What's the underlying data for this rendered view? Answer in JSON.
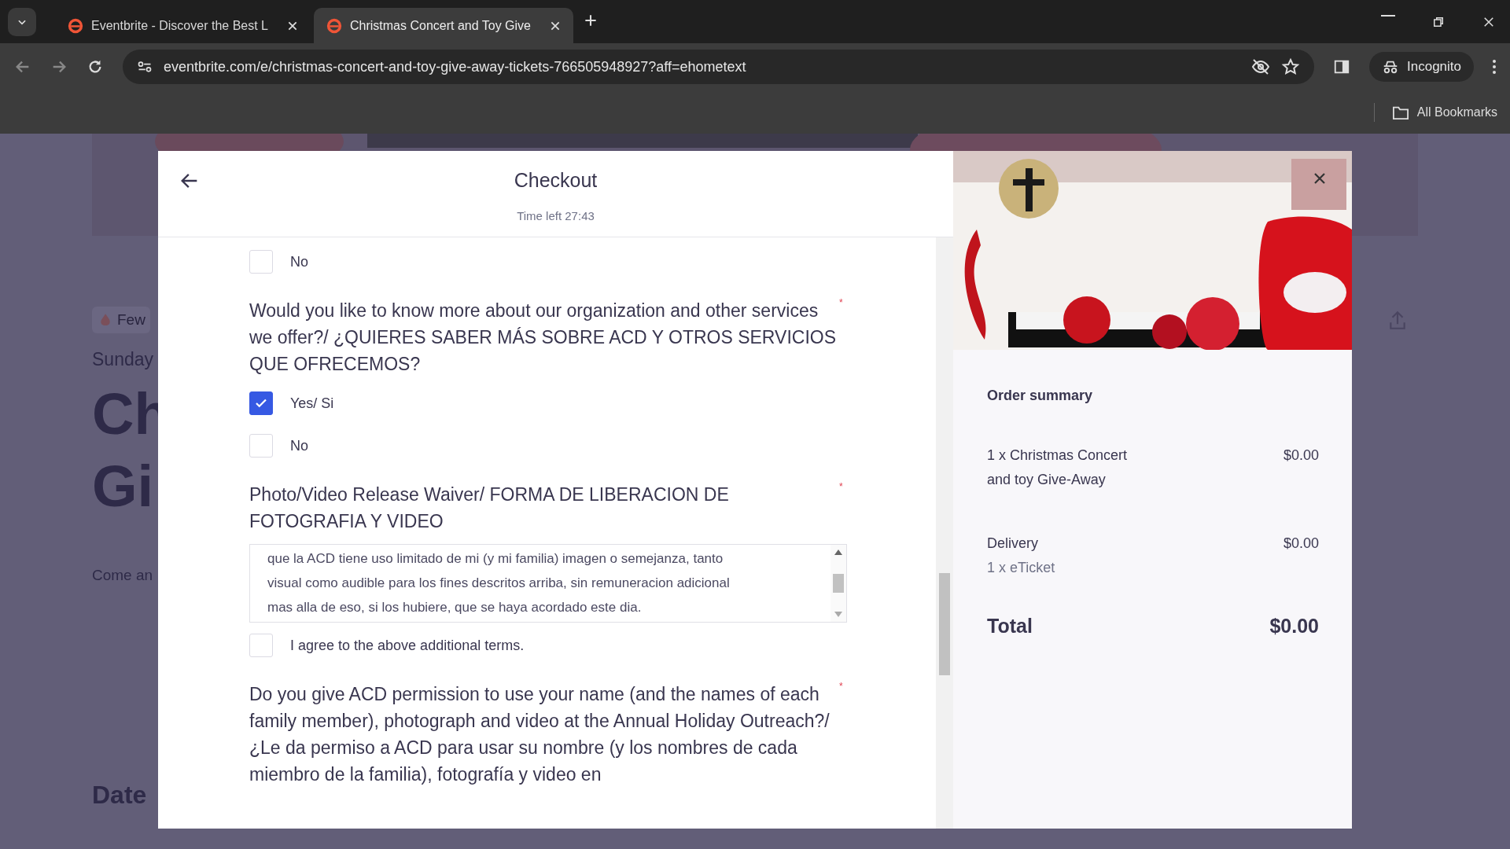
{
  "browser": {
    "tabs": [
      {
        "title": "Eventbrite - Discover the Best L",
        "selected": false
      },
      {
        "title": "Christmas Concert and Toy Give",
        "selected": true
      }
    ],
    "url": "eventbrite.com/e/christmas-concert-and-toy-give-away-tickets-766505948927?aff=ehometext",
    "profile": "Incognito",
    "bookmarks": "All Bookmarks"
  },
  "background_page": {
    "badge": "Few",
    "date": "Sunday",
    "title_lines": [
      "Ch",
      "Gi"
    ],
    "summary": "Come an",
    "section": "Date"
  },
  "checkout": {
    "title": "Checkout",
    "timer": "Time left 27:43",
    "questions": [
      {
        "kind": "choice",
        "options": [
          {
            "label": "No",
            "checked": false
          }
        ]
      },
      {
        "kind": "choice",
        "prompt": "Would you like to know more about our organization and other services we offer?/ ¿QUIERES SABER MÁS SOBRE ACD Y OTROS SERVICIOS QUE OFRECEMOS?",
        "required_mark": "*",
        "options": [
          {
            "label": "Yes/ Si",
            "checked": true
          },
          {
            "label": "No",
            "checked": false
          }
        ]
      },
      {
        "kind": "waiver",
        "prompt": "Photo/Video Release Waiver/ FORMA DE LIBERACION DE FOTOGRAFIA Y VIDEO",
        "required_mark": "*",
        "terms_lines": [
          "que la ACD tiene uso limitado de mi (y mi familia) imagen o semejanza, tanto",
          "visual como audible para los fines descritos arriba, sin remuneracion adicional",
          "mas alla de eso, si los hubiere, que se haya acordado este dia."
        ],
        "agree": {
          "label": "I agree to the above additional terms.",
          "checked": false
        }
      },
      {
        "kind": "choice",
        "prompt": "Do you give ACD permission to use your name (and the names of each family member), photograph and video at the Annual Holiday Outreach?/ ¿Le da permiso a ACD para usar su nombre (y los nombres de cada miembro de la familia), fotografía y video en",
        "required_mark": "*"
      }
    ]
  },
  "order_summary": {
    "heading": "Order summary",
    "items": [
      {
        "name": "1 x Christmas Concert and toy Give-Away",
        "price": "$0.00"
      },
      {
        "name": "Delivery",
        "detail": "1 x eTicket",
        "price": "$0.00"
      }
    ],
    "total_label": "Total",
    "total": "$0.00"
  }
}
